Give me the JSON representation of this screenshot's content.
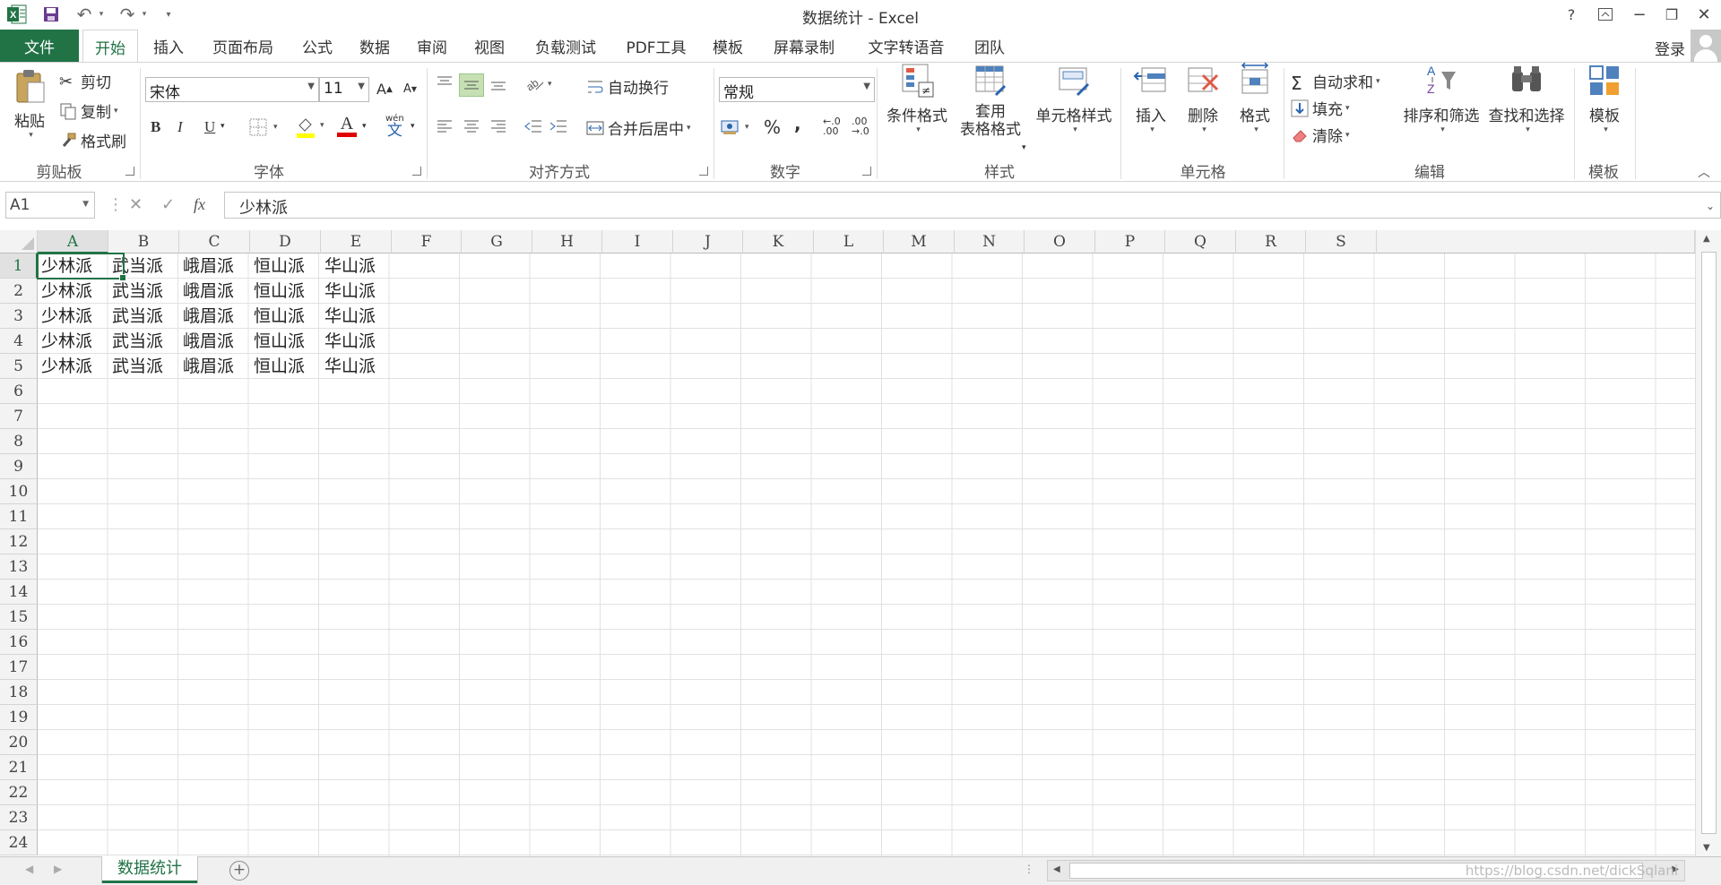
{
  "window": {
    "title": "数据统计 - Excel",
    "controls": {
      "help": "?",
      "minimize": "−",
      "restore": "❐",
      "close": "✕"
    }
  },
  "quick_access": {
    "undo": "↶",
    "redo": "↷",
    "customize": "▾"
  },
  "tabs": {
    "file": "文件",
    "items": [
      "开始",
      "插入",
      "页面布局",
      "公式",
      "数据",
      "审阅",
      "视图",
      "负载测试",
      "PDF工具",
      "模板",
      "屏幕录制",
      "文字转语音",
      "团队"
    ],
    "active": "开始",
    "login": "登录"
  },
  "ribbon": {
    "clipboard": {
      "paste": "粘贴",
      "cut": "剪切",
      "copy": "复制",
      "format_painter": "格式刷",
      "label": "剪贴板"
    },
    "font": {
      "name": "宋体",
      "size": "11",
      "grow": "A",
      "shrink": "A",
      "bold": "B",
      "italic": "I",
      "underline": "U",
      "font_color": "A",
      "phonetic": "文",
      "phonetic_top": "wén",
      "label": "字体"
    },
    "alignment": {
      "wrap_text": "自动换行",
      "merge_center": "合并后居中",
      "label": "对齐方式"
    },
    "number": {
      "format": "常规",
      "percent": "%",
      "comma": ",",
      "increase_decimal": "←.0\n.00",
      "decrease_decimal": ".00\n→.0",
      "label": "数字"
    },
    "styles": {
      "conditional": "条件格式",
      "table_format": "套用\n表格格式",
      "cell_styles": "单元格样式",
      "label": "样式"
    },
    "cells": {
      "insert": "插入",
      "delete": "删除",
      "format": "格式",
      "label": "单元格"
    },
    "editing": {
      "autosum": "自动求和",
      "fill": "填充",
      "clear": "清除",
      "sort_filter": "排序和筛选",
      "find_select": "查找和选择",
      "label": "编辑"
    },
    "templates": {
      "templates": "模板",
      "label": "模板"
    }
  },
  "formula_bar": {
    "name_box": "A1",
    "cancel": "✕",
    "enter": "✓",
    "fx": "fx",
    "content": "少林派"
  },
  "grid": {
    "columns": [
      "A",
      "B",
      "C",
      "D",
      "E",
      "F",
      "G",
      "H",
      "I",
      "J",
      "K",
      "L",
      "M",
      "N",
      "O",
      "P",
      "Q",
      "R",
      "S"
    ],
    "rows": [
      "1",
      "2",
      "3",
      "4",
      "5",
      "6",
      "7",
      "8",
      "9",
      "10",
      "11",
      "12",
      "13",
      "14",
      "15",
      "16",
      "17",
      "18",
      "19",
      "20",
      "21",
      "22",
      "23",
      "24"
    ],
    "selected_cell": "A1",
    "data": [
      [
        "少林派",
        "武当派",
        "峨眉派",
        "恒山派",
        "华山派"
      ],
      [
        "少林派",
        "武当派",
        "峨眉派",
        "恒山派",
        "华山派"
      ],
      [
        "少林派",
        "武当派",
        "峨眉派",
        "恒山派",
        "华山派"
      ],
      [
        "少林派",
        "武当派",
        "峨眉派",
        "恒山派",
        "华山派"
      ],
      [
        "少林派",
        "武当派",
        "峨眉派",
        "恒山派",
        "华山派"
      ]
    ]
  },
  "sheets": {
    "tabs": [
      "数据统计"
    ],
    "active": "数据统计",
    "add": "+",
    "more": "⋮"
  },
  "watermark": "https://blog.csdn.net/dickSqlani",
  "colors": {
    "accent": "#217346",
    "font_red": "#e00000",
    "highlight_yellow": "#ffff00"
  }
}
